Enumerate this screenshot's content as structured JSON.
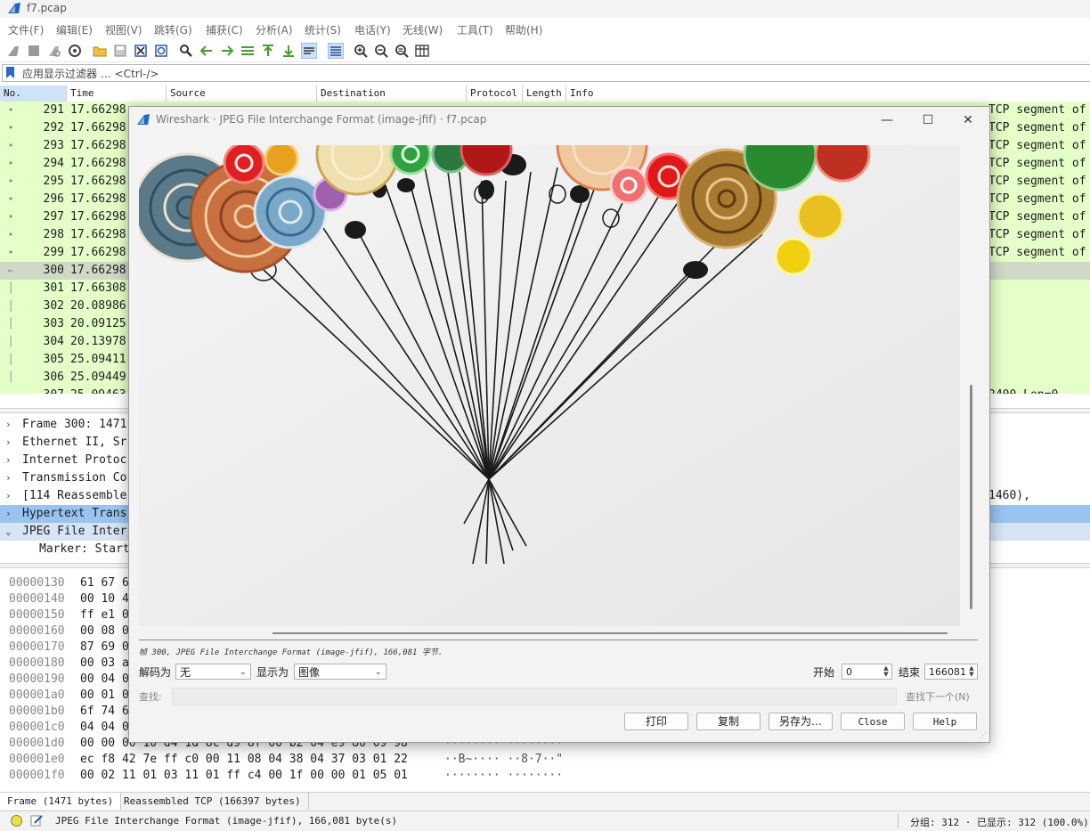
{
  "window": {
    "title": "f7.pcap"
  },
  "menu": [
    "文件(F)",
    "编辑(E)",
    "视图(V)",
    "跳转(G)",
    "捕获(C)",
    "分析(A)",
    "统计(S)",
    "电话(Y)",
    "无线(W)",
    "工具(T)",
    "帮助(H)"
  ],
  "filter": {
    "placeholder": "应用显示过滤器 … <Ctrl-/>"
  },
  "packet_list": {
    "columns": [
      "No.",
      "Time",
      "Source",
      "Destination",
      "Protocol",
      "Length",
      "Info"
    ],
    "rows": [
      {
        "no": "291",
        "time": "17.66298",
        "info": "TCP segment of"
      },
      {
        "no": "292",
        "time": "17.66298",
        "info": "TCP segment of"
      },
      {
        "no": "293",
        "time": "17.66298",
        "info": "TCP segment of"
      },
      {
        "no": "294",
        "time": "17.66298",
        "info": "TCP segment of"
      },
      {
        "no": "295",
        "time": "17.66298",
        "info": "TCP segment of"
      },
      {
        "no": "296",
        "time": "17.66298",
        "info": "TCP segment of"
      },
      {
        "no": "297",
        "time": "17.66298",
        "info": "TCP segment of"
      },
      {
        "no": "298",
        "time": "17.66298",
        "info": "TCP segment of"
      },
      {
        "no": "299",
        "time": "17.66298",
        "info": "TCP segment of"
      },
      {
        "no": "300",
        "time": "17.66298",
        "info": ""
      },
      {
        "no": "301",
        "time": "17.66308",
        "info": ""
      },
      {
        "no": "302",
        "time": "20.08986",
        "info": ""
      },
      {
        "no": "303",
        "time": "20.09125",
        "info": ""
      },
      {
        "no": "304",
        "time": "20.13978",
        "info": ""
      },
      {
        "no": "305",
        "time": "25.09411",
        "info": ""
      },
      {
        "no": "306",
        "time": "25.09449",
        "info": ""
      },
      {
        "no": "307",
        "time": "25.09463",
        "info": "2400 Len=0"
      }
    ]
  },
  "details": {
    "items": [
      {
        "text": "Frame 300: 1471",
        "expanded": false
      },
      {
        "text": "Ethernet II, Sr",
        "expanded": false
      },
      {
        "text": "Internet Protoc",
        "expanded": false
      },
      {
        "text": "Transmission Co",
        "expanded": false
      },
      {
        "text": "[114 Reassemble",
        "tail": "1460), #191(146",
        "expanded": false
      },
      {
        "text": "Hypertext Trans",
        "expanded": false
      },
      {
        "text": "JPEG File Inter",
        "expanded": true
      },
      {
        "text": "Marker: Start",
        "expanded": null
      }
    ]
  },
  "hex": {
    "rows": [
      {
        "offset": "00000130",
        "hex": "61 67 6",
        "ascii": ""
      },
      {
        "offset": "00000140",
        "hex": "00 10 4",
        "ascii": ""
      },
      {
        "offset": "00000150",
        "hex": "ff e1 0",
        "ascii": ""
      },
      {
        "offset": "00000160",
        "hex": "00 08 0",
        "ascii": ""
      },
      {
        "offset": "00000170",
        "hex": "87 69 0",
        "ascii": ""
      },
      {
        "offset": "00000180",
        "hex": "00 03 a",
        "ascii": ""
      },
      {
        "offset": "00000190",
        "hex": "00 04 0",
        "ascii": ""
      },
      {
        "offset": "000001a0",
        "hex": "00 01 0",
        "ascii": ""
      },
      {
        "offset": "000001b0",
        "hex": "6f 74 6",
        "ascii": ""
      },
      {
        "offset": "000001c0",
        "hex": "04 04 0",
        "ascii": ""
      },
      {
        "offset": "000001d0",
        "hex": "00 00 00 10 d4 1d 8c d9  8f 00 b2 04 e9 80 09 98",
        "ascii": "········ ········"
      },
      {
        "offset": "000001e0",
        "hex": "ec f8 42 7e ff c0 00 11  08 04 38 04 37 03 01 22",
        "ascii": "··B~···· ··8·7··\""
      },
      {
        "offset": "000001f0",
        "hex": "00 02 11 01 03 11 01 ff  c4 00 1f 00 00 01 05 01",
        "ascii": "········ ········"
      }
    ]
  },
  "byte_tabs": [
    "Frame (1471 bytes)",
    "Reassembled TCP (166397 bytes)"
  ],
  "status": {
    "message": "JPEG File Interchange Format (image-jfif), 166,081 byte(s)",
    "stats": "分组: 312 · 已显示: 312 (100.0%)"
  },
  "dialog": {
    "title": "Wireshark · JPEG File Interchange Format (image-jfif) · f7.pcap",
    "window_controls": {
      "minimize": "—",
      "maximize": "☐",
      "close": "✕"
    },
    "caption": "帧 300, JPEG File Interchange Format (image-jfif), 166,081 字节.",
    "decode_label": "解码为",
    "decode_value": "无",
    "show_label": "显示为",
    "show_value": "图像",
    "start_label": "开始",
    "start_value": "0",
    "end_label": "结束",
    "end_value": "166081",
    "find_label": "查找:",
    "find_next": "查找下一个(N)",
    "buttons": {
      "print": "打印",
      "copy": "复制",
      "save_as": "另存为…",
      "close": "Close",
      "help": "Help"
    }
  },
  "colors": {
    "row_bg": "#e4ffc7",
    "selected_row": "#d0d8c8",
    "selected_tree": "#99c4f0",
    "accent": "#1a68c4"
  }
}
